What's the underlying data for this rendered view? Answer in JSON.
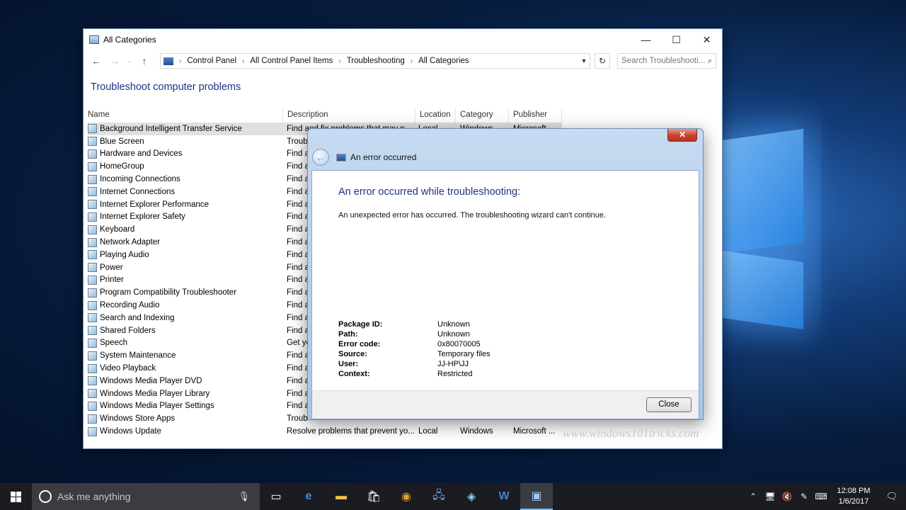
{
  "explorer": {
    "window_title": "All Categories",
    "controls": {
      "minimize": "—",
      "maximize": "☐",
      "close": "✕"
    },
    "breadcrumb": [
      "Control Panel",
      "All Control Panel Items",
      "Troubleshooting",
      "All Categories"
    ],
    "search_placeholder": "Search Troubleshooti...",
    "page_title": "Troubleshoot computer problems",
    "columns": [
      "Name",
      "Description",
      "Location",
      "Category",
      "Publisher"
    ],
    "rows": [
      {
        "name": "Background Intelligent Transfer Service",
        "desc": "Find and fix problems that may p...",
        "loc": "Local",
        "cat": "Windows",
        "pub": "Microsoft ..."
      },
      {
        "name": "Blue Screen",
        "desc": "Troub",
        "loc": "",
        "cat": "",
        "pub": ""
      },
      {
        "name": "Hardware and Devices",
        "desc": "Find a",
        "loc": "",
        "cat": "",
        "pub": ""
      },
      {
        "name": "HomeGroup",
        "desc": "Find a",
        "loc": "",
        "cat": "",
        "pub": ""
      },
      {
        "name": "Incoming Connections",
        "desc": "Find a",
        "loc": "",
        "cat": "",
        "pub": ""
      },
      {
        "name": "Internet Connections",
        "desc": "Find a",
        "loc": "",
        "cat": "",
        "pub": ""
      },
      {
        "name": "Internet Explorer Performance",
        "desc": "Find a",
        "loc": "",
        "cat": "",
        "pub": ""
      },
      {
        "name": "Internet Explorer Safety",
        "desc": "Find a",
        "loc": "",
        "cat": "",
        "pub": ""
      },
      {
        "name": "Keyboard",
        "desc": "Find a",
        "loc": "",
        "cat": "",
        "pub": ""
      },
      {
        "name": "Network Adapter",
        "desc": "Find a",
        "loc": "",
        "cat": "",
        "pub": ""
      },
      {
        "name": "Playing Audio",
        "desc": "Find a",
        "loc": "",
        "cat": "",
        "pub": ""
      },
      {
        "name": "Power",
        "desc": "Find a",
        "loc": "",
        "cat": "",
        "pub": ""
      },
      {
        "name": "Printer",
        "desc": "Find a",
        "loc": "",
        "cat": "",
        "pub": ""
      },
      {
        "name": "Program Compatibility Troubleshooter",
        "desc": "Find a",
        "loc": "",
        "cat": "",
        "pub": ""
      },
      {
        "name": "Recording Audio",
        "desc": "Find a",
        "loc": "",
        "cat": "",
        "pub": ""
      },
      {
        "name": "Search and Indexing",
        "desc": "Find a",
        "loc": "",
        "cat": "",
        "pub": ""
      },
      {
        "name": "Shared Folders",
        "desc": "Find a",
        "loc": "",
        "cat": "",
        "pub": ""
      },
      {
        "name": "Speech",
        "desc": "Get yo",
        "loc": "",
        "cat": "",
        "pub": ""
      },
      {
        "name": "System Maintenance",
        "desc": "Find a",
        "loc": "",
        "cat": "",
        "pub": ""
      },
      {
        "name": "Video Playback",
        "desc": "Find a",
        "loc": "",
        "cat": "",
        "pub": ""
      },
      {
        "name": "Windows Media Player DVD",
        "desc": "Find a",
        "loc": "",
        "cat": "",
        "pub": ""
      },
      {
        "name": "Windows Media Player Library",
        "desc": "Find a",
        "loc": "",
        "cat": "",
        "pub": ""
      },
      {
        "name": "Windows Media Player Settings",
        "desc": "Find a",
        "loc": "",
        "cat": "",
        "pub": ""
      },
      {
        "name": "Windows Store Apps",
        "desc": "Troub",
        "loc": "",
        "cat": "",
        "pub": ""
      },
      {
        "name": "Windows Update",
        "desc": "Resolve problems that prevent yo...",
        "loc": "Local",
        "cat": "Windows",
        "pub": "Microsoft ..."
      }
    ]
  },
  "dialog": {
    "title": "An error occurred",
    "heading": "An error occurred while troubleshooting:",
    "message": "An unexpected error has occurred. The troubleshooting wizard can't continue.",
    "details": [
      {
        "k": "Package ID:",
        "v": "Unknown"
      },
      {
        "k": "Path:",
        "v": "Unknown"
      },
      {
        "k": "Error code:",
        "v": "0x80070005"
      },
      {
        "k": "Source:",
        "v": "Temporary files"
      },
      {
        "k": "User:",
        "v": "JJ-HP\\JJ"
      },
      {
        "k": "Context:",
        "v": "Restricted"
      }
    ],
    "close_x": "✕",
    "close_label": "Close"
  },
  "watermark": "www.windows101tricks.com",
  "taskbar": {
    "search_placeholder": "Ask me anything",
    "icons": [
      "task-view-icon",
      "edge-icon",
      "file-explorer-icon",
      "store-icon",
      "chrome-icon",
      "network-app-icon",
      "paint-icon",
      "word-icon",
      "control-panel-icon"
    ],
    "time": "12:08 PM",
    "date": "1/6/2017"
  }
}
